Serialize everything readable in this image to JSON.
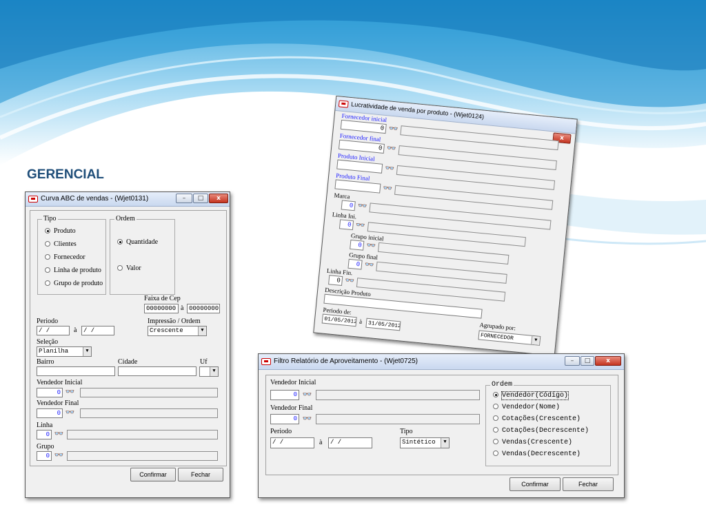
{
  "slide": {
    "title": "GERENCIAL"
  },
  "w1": {
    "title": "Curva ABC de vendas - (Wjet0131)",
    "tipo": {
      "title": "Tipo",
      "options": [
        "Produto",
        "Clientes",
        "Fornecedor",
        "Linha de produto",
        "Grupo de produto"
      ],
      "selected": "Produto"
    },
    "ordem": {
      "title": "Ordem",
      "options": [
        "Quantidade",
        "Valor"
      ],
      "selected": "Quantidade"
    },
    "faixa_cep": {
      "label": "Faixa de Cep",
      "from": "00000000",
      "sep": "à",
      "to": "00000000"
    },
    "periodo": {
      "label": "Periodo",
      "from": " /  / ",
      "sep": "à",
      "to": " /  / "
    },
    "impressao": {
      "label": "Impressão / Ordem",
      "value": "Crescente"
    },
    "selecao": {
      "label": "Seleção",
      "value": "Planilha"
    },
    "bairro": {
      "label": "Bairro",
      "value": ""
    },
    "cidade": {
      "label": "Cidade",
      "value": ""
    },
    "uf": {
      "label": "Uf",
      "value": ""
    },
    "vendedor_inicial": {
      "label": "Vendedor Inicial",
      "value": "0"
    },
    "vendedor_final": {
      "label": "Vendedor Final",
      "value": "0"
    },
    "linha": {
      "label": "Linha",
      "value": "0"
    },
    "grupo": {
      "label": "Grupo",
      "value": "0"
    },
    "buttons": {
      "confirmar": "Confirmar",
      "fechar": "Fechar"
    }
  },
  "w2": {
    "title": "Lucratividade de venda por produto - (Wjet0124)",
    "fornecedor_inicial": {
      "label": "Fornecedor inicial",
      "value": "0"
    },
    "fornecedor_final": {
      "label": "Fornecedor final",
      "value": "0"
    },
    "produto_inicial": {
      "label": "Produto Inicial",
      "value": ""
    },
    "produto_final": {
      "label": "Produto Final",
      "value": ""
    },
    "marca": {
      "label": "Marca",
      "value": "0"
    },
    "linha_ini": {
      "label": "Linha Ini.",
      "value": "0"
    },
    "grupo_inicial": {
      "label": "Grupo inicial",
      "value": "0"
    },
    "grupo_final": {
      "label": "Grupo final",
      "value": "0"
    },
    "linha_fin": {
      "label": "Linha Fin.",
      "value": "0"
    },
    "descricao": {
      "label": "Descrição Produto",
      "value": ""
    },
    "periodo": {
      "label": "Periodo de:",
      "from": "01/05/2012",
      "sep": "à",
      "to": "31/05/2012"
    },
    "agrupado": {
      "label": "Agrupado por:",
      "value": "FORNECEDOR"
    }
  },
  "w3": {
    "title": "Filtro Relatório de Aproveitamento - (Wjet0725)",
    "vendedor_inicial": {
      "label": "Vendedor Inicial",
      "value": "0"
    },
    "vendedor_final": {
      "label": "Vendedor Final",
      "value": "0"
    },
    "periodo": {
      "label": "Periodo",
      "from": " /  / ",
      "sep": "à",
      "to": " /  / "
    },
    "tipo": {
      "label": "Tipo",
      "value": "Sintético"
    },
    "ordem": {
      "title": "Ordem",
      "options": [
        "Vendedor(Código)",
        "Vendedor(Nome)",
        "Cotações(Crescente)",
        "Cotações(Decrescente)",
        "Vendas(Crescente)",
        "Vendas(Decrescente)"
      ],
      "selected": "Vendedor(Código)"
    },
    "buttons": {
      "confirmar": "Confirmar",
      "fechar": "Fechar"
    }
  },
  "window_controls": {
    "minimize": "–",
    "maximize": "□",
    "close": "x"
  },
  "icons": {
    "binoculars": "binoculars-icon",
    "app": "app-icon"
  }
}
